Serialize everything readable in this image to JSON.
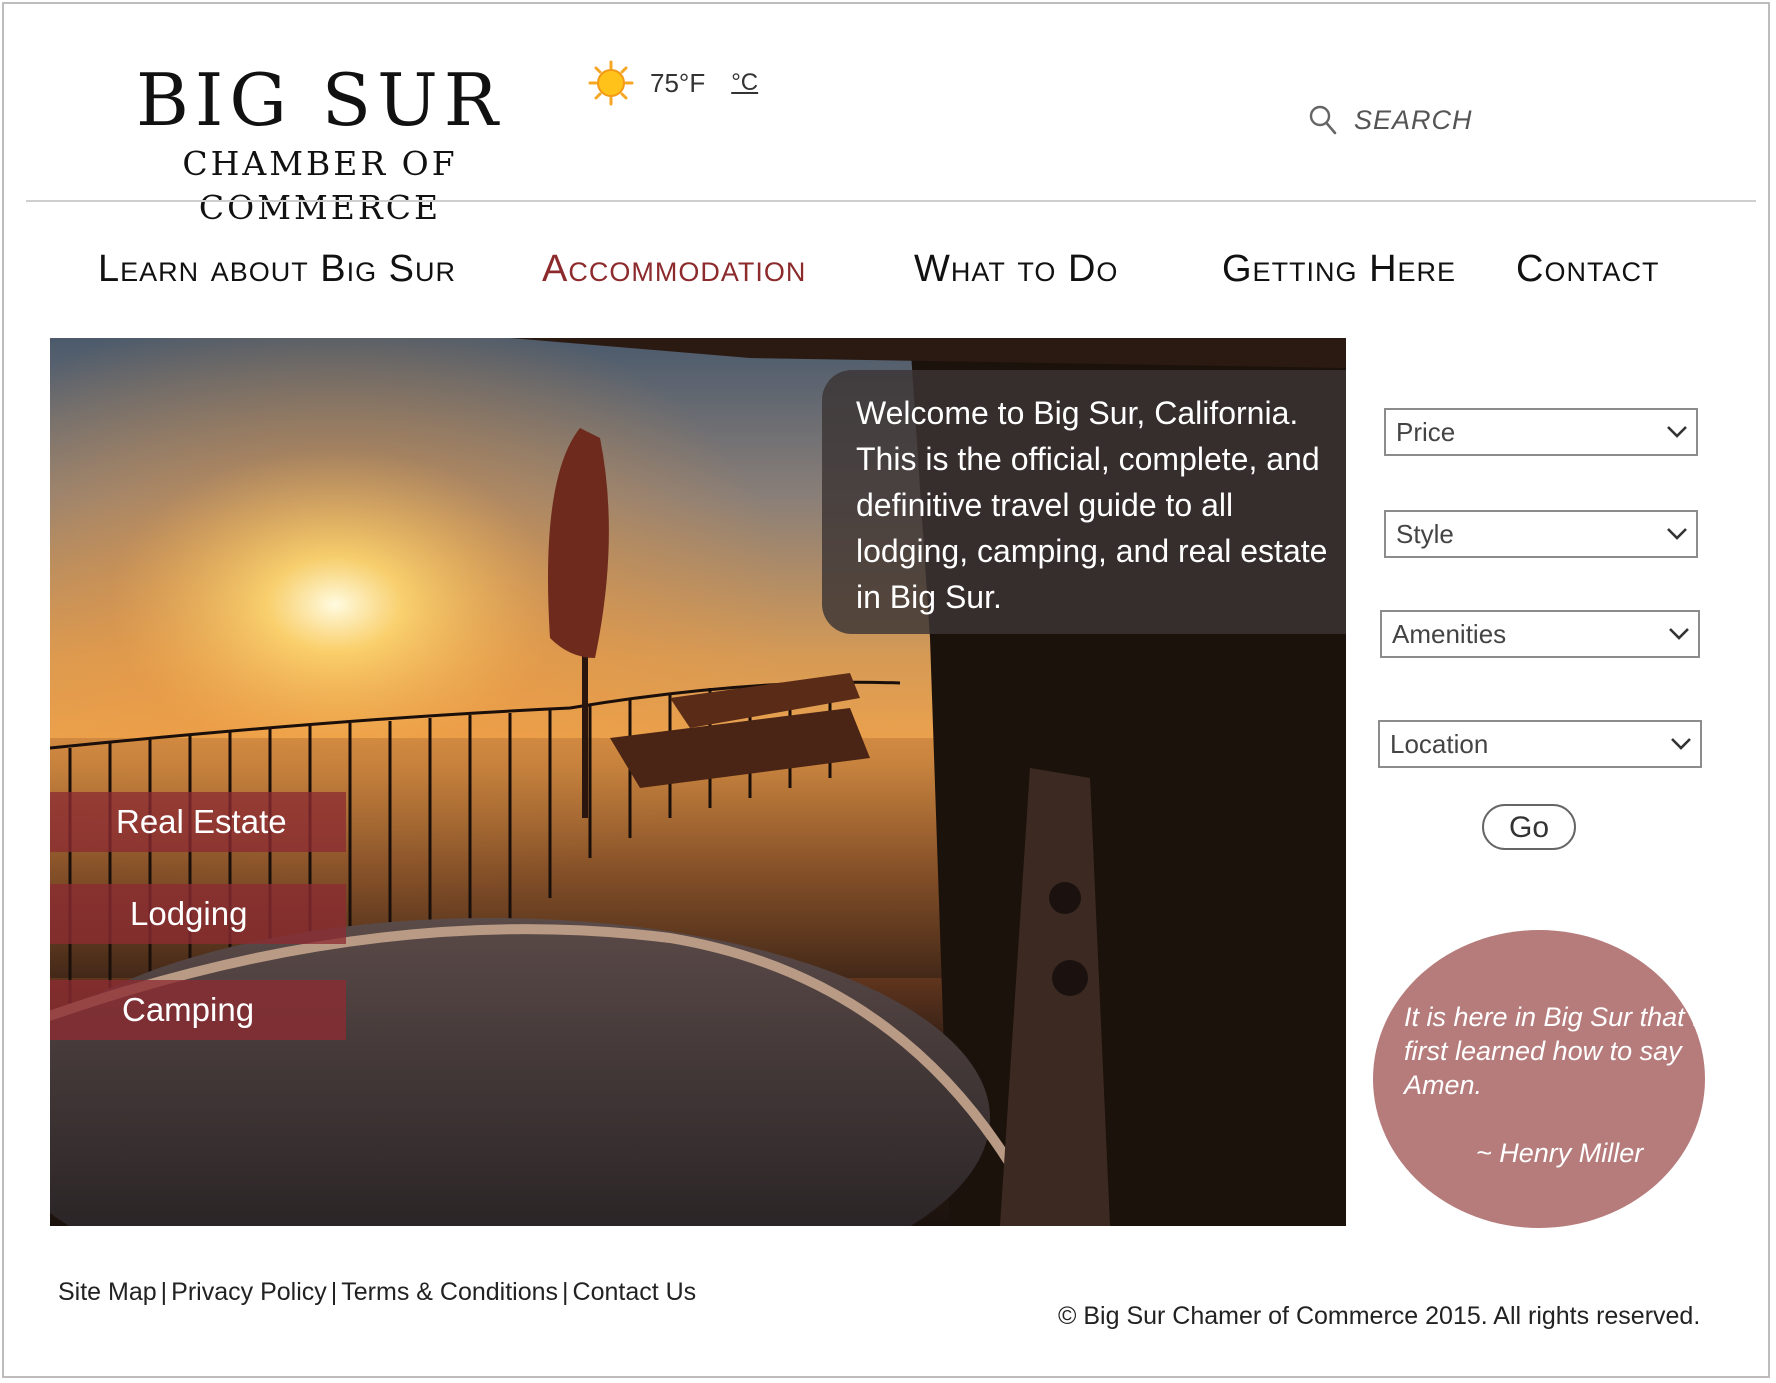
{
  "header": {
    "logo_title": "BIG SUR",
    "logo_subtitle": "CHAMBER OF COMMERCE",
    "weather": {
      "icon": "sun-icon",
      "temp_f": "75°F",
      "unit_c": "°C"
    },
    "search_label": "SEARCH"
  },
  "nav": {
    "items": [
      {
        "label": "Learn about Big Sur"
      },
      {
        "label": "Accommodation"
      },
      {
        "label": "What to Do"
      },
      {
        "label": "Getting Here"
      },
      {
        "label": "Contact"
      }
    ],
    "active_item": "Accommodation",
    "active_color": "#8c2a2c"
  },
  "hero": {
    "welcome_text": "Welcome to Big Sur, California. This is the official, complete, and definitive travel guide to all lodging, camping, and real estate in Big Sur.",
    "categories": [
      {
        "label": "Real Estate"
      },
      {
        "label": "Lodging"
      },
      {
        "label": "Camping"
      }
    ],
    "category_color": "#8c2c32"
  },
  "filters": {
    "price": "Price",
    "style": "Style",
    "amenities": "Amenities",
    "location": "Location",
    "go_label": "Go"
  },
  "quote": {
    "text": "It is here in Big Sur that I first learned how to say Amen.",
    "author": "~ Henry Miller",
    "bubble_color": "#b67b7b"
  },
  "footer": {
    "links": [
      "Site Map",
      "Privacy Policy",
      "Terms & Conditions",
      "Contact Us"
    ],
    "copyright": "© Big Sur Chamer of Commerce 2015. All rights reserved."
  }
}
